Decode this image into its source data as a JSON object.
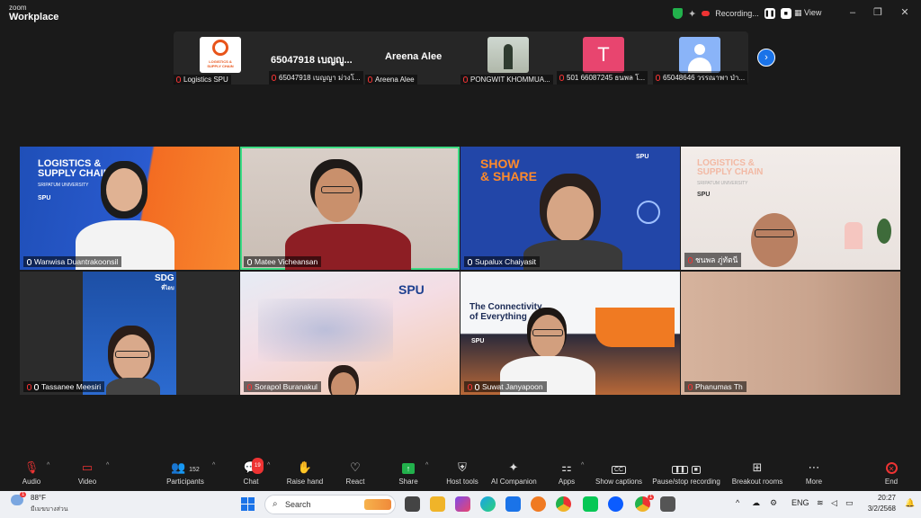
{
  "app": {
    "brand_line1": "zoom",
    "brand_line2": "Workplace"
  },
  "recording": {
    "label": "Recording..."
  },
  "view": {
    "label": "View"
  },
  "window_controls": [
    "–",
    "❐",
    "✕"
  ],
  "strip": {
    "thumbs": [
      {
        "label": "Logistics SPU",
        "logo_line1": "LOGISTICS &",
        "logo_line2": "SUPPLY CHAIN"
      },
      {
        "label": "65047918 เบญญา ม่วงโ...",
        "big": "65047918 เบญญู..."
      },
      {
        "label": "Areena Alee",
        "big": "Areena Alee"
      },
      {
        "label": "PONGWIT KHOMMUA..."
      },
      {
        "label": "501 66087245 ธนพล โ...",
        "avatar": "T"
      },
      {
        "label": "65048646 วรรณาพา ป่า..."
      }
    ],
    "next": "›"
  },
  "gallery": [
    {
      "name": "Wanwisa Duantrakoonsil",
      "bg_line1": "LOGISTICS &",
      "bg_line2": "SUPPLY CHAIN",
      "bg_line3": "SRIPATUM UNIVERSITY",
      "bg_logo": "SPU"
    },
    {
      "name": "Matee Vicheansan"
    },
    {
      "name": "Supalux Chaiyasit",
      "bg_line1": "SHOW",
      "bg_line2": "& SHARE",
      "bg_logo": "SPU"
    },
    {
      "name": "ชนพล ภู่ทัตนี",
      "bg_line1": "LOGISTICS &",
      "bg_line2": "SUPPLY CHAIN",
      "bg_line3": "SRIPATUM UNIVERSITY",
      "bg_logo": "SPU"
    },
    {
      "name": "Tassanee Meesiri",
      "bg_line1": "SDG",
      "bg_line2": "ที่ไอบ"
    },
    {
      "name": "Sorapol Buranakul",
      "bg_logo": "SPU"
    },
    {
      "name": "Suwat Janyapoon",
      "bg_line1": "The Connectivity",
      "bg_line2": "of Everything",
      "bg_logo": "SPU"
    },
    {
      "name": "Phanumas Th"
    }
  ],
  "toolbar": {
    "audio": "Audio",
    "video": "Video",
    "participants": "Participants",
    "participants_count": "152",
    "chat": "Chat",
    "chat_badge": "19",
    "raise_hand": "Raise hand",
    "react": "React",
    "share": "Share",
    "host_tools": "Host tools",
    "ai_companion": "AI Companion",
    "apps": "Apps",
    "show_captions": "Show captions",
    "pause_recording": "Pause/stop recording",
    "breakout_rooms": "Breakout rooms",
    "more": "More",
    "end": "End",
    "captions_icon": "CC"
  },
  "taskbar": {
    "weather_temp": "88°F",
    "weather_desc": "มีเมฆบางส่วน",
    "weather_badge": "1",
    "search_placeholder": "Search",
    "lang": "ENG",
    "time": "20:27",
    "date": "3/2/2568",
    "tray_badge": "1"
  },
  "colors": {
    "accent_green": "#3ddc84",
    "record_red": "#ee3333",
    "share_green": "#22b14c",
    "zoom_blue": "#1a73e8"
  }
}
